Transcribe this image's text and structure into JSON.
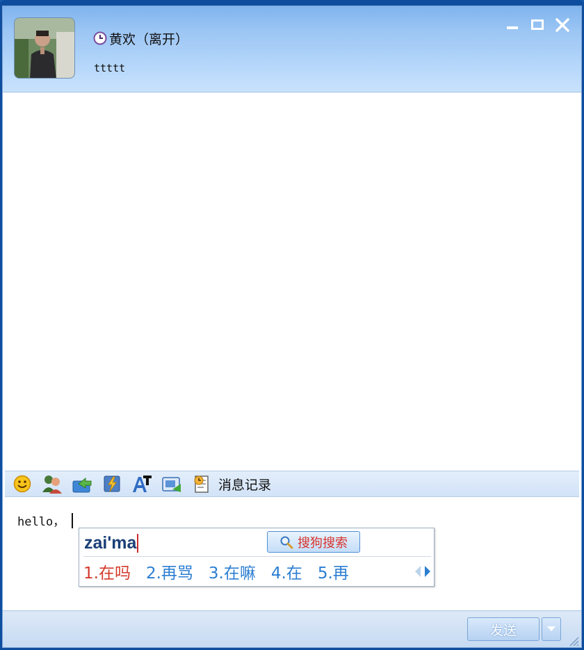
{
  "window": {
    "title": ""
  },
  "header": {
    "contact_name": "黄欢（离开）",
    "signature": "ttttt",
    "status_icon": "clock-away-icon",
    "avatar_icon": "contact-photo"
  },
  "window_controls": [
    {
      "name": "minimize",
      "icon": "minimize-icon"
    },
    {
      "name": "maximize",
      "icon": "maximize-icon"
    },
    {
      "name": "close",
      "icon": "close-icon"
    }
  ],
  "toolbar": {
    "icons": [
      "smiley-icon",
      "contacts-icon",
      "file-transfer-icon",
      "shake-icon",
      "font-icon",
      "screenshot-icon",
      "history-icon"
    ],
    "history_label": "消息记录"
  },
  "input": {
    "text": "hello，"
  },
  "ime": {
    "composition": "zai'ma",
    "search_label": "搜狗搜索",
    "candidates": [
      "1.在吗",
      "2.再骂",
      "3.在嘛",
      "4.在",
      "5.再"
    ],
    "active_color": "#d43a2c",
    "candidate_color": "#2b7ed2"
  },
  "bottom": {
    "send_label": "发送"
  },
  "colors": {
    "accent": "#1c5fb0",
    "header_top": "#7fb4ee"
  }
}
